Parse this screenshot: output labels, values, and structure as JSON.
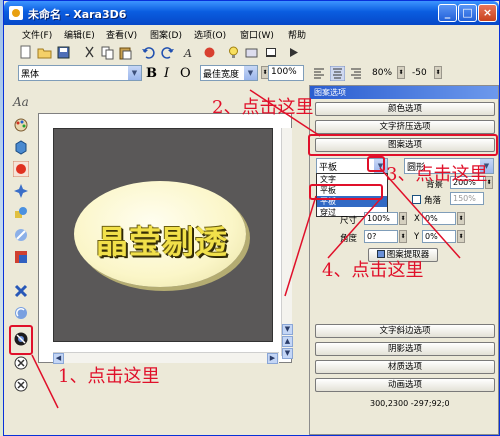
{
  "window": {
    "title": "未命名 - Xara3D6"
  },
  "menu": [
    "文件(F)",
    "编辑(E)",
    "查看(V)",
    "图案(D)",
    "选项(O)",
    "窗口(W)",
    "帮助"
  ],
  "toolbar2": {
    "font": "黑体",
    "bold": "B",
    "italic": "I",
    "outline": "O",
    "width_mode": "最佳宽度",
    "zoom": "100%",
    "spacing": "80%",
    "offset": "-50"
  },
  "canvas": {
    "text": "晶莹剔透"
  },
  "panel": {
    "title": "图案选项",
    "buttons": {
      "color": "颜色选项",
      "extrude": "文字挤压选项",
      "pattern": "图案选项",
      "bevel": "文字斜边选项",
      "shadow": "阴影选项",
      "material": "材质选项",
      "animation": "动画选项"
    },
    "mode_select": "平板",
    "shape_select": "圆形",
    "dropdown_options": [
      "文字",
      "平板",
      "穿过"
    ],
    "dropdown_selected": "平板",
    "behind_label": "背景",
    "behind_value": "200%",
    "corner_label": "角落",
    "corner_value": "150%",
    "size_label": "尺寸",
    "size_value": "100%",
    "x_label": "X",
    "x_value": "0%",
    "y_label": "Y",
    "y_value": "0%",
    "angle_label": "角度",
    "angle_value": "0?",
    "extra_value": "0%",
    "sampler_button": "图案提取器",
    "status_coords": "300,2300 -297;92;0"
  },
  "annotations": {
    "a1": "1、点击这里",
    "a2": "2、点击这里",
    "a3": "3、点击这里",
    "a4": "4、点击这里"
  },
  "colors": {
    "annotation_red": "#e0102a",
    "title_blue": "#0a5de0"
  }
}
